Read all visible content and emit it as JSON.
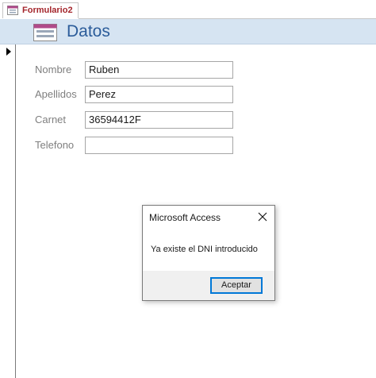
{
  "document_tab": {
    "label": "Formulario2",
    "icon": "form-icon"
  },
  "form_header": {
    "title": "Datos",
    "icon": "form-header-icon"
  },
  "record_selector": {
    "icon": "current-record-arrow-icon"
  },
  "fields": [
    {
      "label": "Nombre",
      "value": "Ruben"
    },
    {
      "label": "Apellidos",
      "value": "Perez"
    },
    {
      "label": "Carnet",
      "value": "36594412F"
    },
    {
      "label": "Telefono",
      "value": ""
    }
  ],
  "dialog": {
    "title": "Microsoft Access",
    "message": "Ya existe el DNI introducido",
    "ok_label": "Aceptar",
    "close_icon": "close-icon"
  },
  "colors": {
    "tab_label": "#a4262c",
    "header_band": "#d6e4f2",
    "header_title": "#2b5c9a",
    "button_focus": "#0078d7"
  }
}
